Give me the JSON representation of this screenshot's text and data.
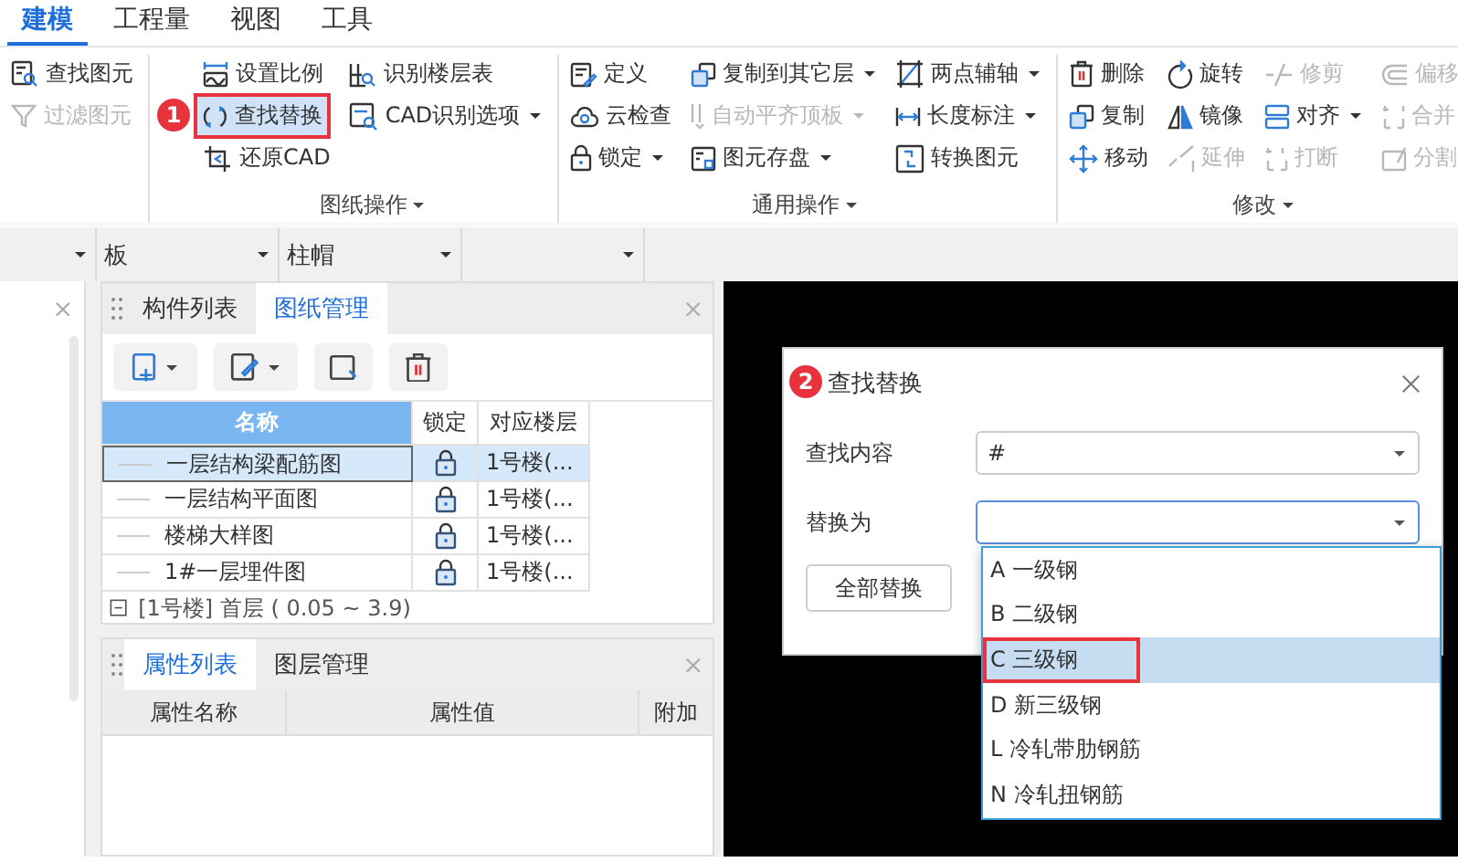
{
  "menu_tabs": [
    {
      "label": "建模",
      "selected": true
    },
    {
      "label": "工程量",
      "selected": false
    },
    {
      "label": "视图",
      "selected": false
    },
    {
      "label": "工具",
      "selected": false
    }
  ],
  "ribbon": {
    "groups": [
      {
        "columns": [
          [
            {
              "label": "查找图元",
              "disabled": false,
              "dropdown": false,
              "highlighted": false
            },
            {
              "label": "过滤图元",
              "disabled": true,
              "dropdown": false,
              "highlighted": false
            }
          ]
        ]
      },
      {
        "label": "图纸操作",
        "columns": [
          [
            {
              "label": "设置比例",
              "disabled": false,
              "dropdown": false,
              "highlighted": false
            },
            {
              "label": "查找替换",
              "disabled": false,
              "dropdown": false,
              "highlighted": true,
              "badge": "1"
            },
            {
              "label": "还原CAD",
              "disabled": false,
              "dropdown": false,
              "highlighted": false
            }
          ],
          [
            {
              "label": "识别楼层表",
              "disabled": false,
              "dropdown": false,
              "highlighted": false
            },
            {
              "label": "CAD识别选项",
              "disabled": false,
              "dropdown": true,
              "highlighted": false
            }
          ]
        ]
      },
      {
        "label": "通用操作",
        "columns": [
          [
            {
              "label": "定义",
              "disabled": false,
              "dropdown": false,
              "highlighted": false
            },
            {
              "label": "云检查",
              "disabled": false,
              "dropdown": false,
              "highlighted": false
            },
            {
              "label": "锁定",
              "disabled": false,
              "dropdown": true,
              "highlighted": false
            }
          ],
          [
            {
              "label": "复制到其它层",
              "disabled": false,
              "dropdown": true,
              "highlighted": false
            },
            {
              "label": "自动平齐顶板",
              "disabled": true,
              "dropdown": true,
              "highlighted": false
            },
            {
              "label": "图元存盘",
              "disabled": false,
              "dropdown": true,
              "highlighted": false
            }
          ],
          [
            {
              "label": "两点辅轴",
              "disabled": false,
              "dropdown": true,
              "highlighted": false
            },
            {
              "label": "长度标注",
              "disabled": false,
              "dropdown": true,
              "highlighted": false
            },
            {
              "label": "转换图元",
              "disabled": false,
              "dropdown": false,
              "highlighted": false
            }
          ]
        ]
      },
      {
        "label": "修改",
        "columns": [
          [
            {
              "label": "删除",
              "disabled": false,
              "dropdown": false,
              "highlighted": false
            },
            {
              "label": "复制",
              "disabled": false,
              "dropdown": false,
              "highlighted": false
            },
            {
              "label": "移动",
              "disabled": false,
              "dropdown": false,
              "highlighted": false
            }
          ],
          [
            {
              "label": "旋转",
              "disabled": false,
              "dropdown": false,
              "highlighted": false
            },
            {
              "label": "镜像",
              "disabled": false,
              "dropdown": false,
              "highlighted": false
            },
            {
              "label": "延伸",
              "disabled": true,
              "dropdown": false,
              "highlighted": false
            }
          ],
          [
            {
              "label": "修剪",
              "disabled": true,
              "dropdown": false,
              "highlighted": false
            },
            {
              "label": "对齐",
              "disabled": false,
              "dropdown": true,
              "highlighted": false
            },
            {
              "label": "打断",
              "disabled": true,
              "dropdown": false,
              "highlighted": false
            }
          ],
          [
            {
              "label": "偏移",
              "disabled": true,
              "dropdown": false,
              "highlighted": false
            },
            {
              "label": "合并",
              "disabled": true,
              "dropdown": false,
              "highlighted": false
            },
            {
              "label": "分割",
              "disabled": true,
              "dropdown": false,
              "highlighted": false
            }
          ]
        ]
      }
    ]
  },
  "filter_dropdowns": [
    {
      "kind": "select"
    },
    {
      "kind": "select",
      "value": "板"
    },
    {
      "kind": "select",
      "value": "柱帽"
    },
    {
      "kind": "select"
    }
  ],
  "drawing_panel": {
    "tabs": [
      {
        "label": "构件列表",
        "selected": false
      },
      {
        "label": "图纸管理",
        "selected": true
      }
    ],
    "columns": [
      "名称",
      "锁定",
      "对应楼层"
    ],
    "rows": [
      {
        "kind": "drawing",
        "name": "一层结构梁配筋图",
        "locked": true,
        "floor": "1号楼(...",
        "selected": true
      },
      {
        "kind": "drawing",
        "name": "一层结构平面图",
        "locked": true,
        "floor": "1号楼(...",
        "selected": false
      },
      {
        "kind": "drawing",
        "name": "楼梯大样图",
        "locked": true,
        "floor": "1号楼(...",
        "selected": false
      },
      {
        "kind": "drawing",
        "name": "1#一层埋件图",
        "locked": true,
        "floor": "1号楼(...",
        "selected": false
      },
      {
        "kind": "group",
        "name": "[1号楼] 首层 ( 0.05 ~ 3.9)",
        "expanded": true
      }
    ]
  },
  "property_panel": {
    "tabs": [
      {
        "label": "属性列表",
        "selected": true
      },
      {
        "label": "图层管理",
        "selected": false
      }
    ],
    "columns": [
      "属性名称",
      "属性值",
      "附加"
    ]
  },
  "dialog": {
    "title": "查找替换",
    "badge": "2",
    "fields": [
      {
        "label": "查找内容",
        "value": "#",
        "focused": false
      },
      {
        "label": "替换为",
        "focused": true
      }
    ],
    "options": [
      {
        "label": "A 一级钢",
        "selected": false,
        "highlighted": false
      },
      {
        "label": "B 二级钢",
        "selected": false,
        "highlighted": false
      },
      {
        "label": "C 三级钢",
        "selected": true,
        "highlighted": true
      },
      {
        "label": "D 新三级钢",
        "selected": false,
        "highlighted": false
      },
      {
        "label": "L 冷轧带肋钢筋",
        "selected": false,
        "highlighted": false
      },
      {
        "label": "N 冷轧扭钢筋",
        "selected": false,
        "highlighted": false
      }
    ],
    "button": "全部替换"
  }
}
